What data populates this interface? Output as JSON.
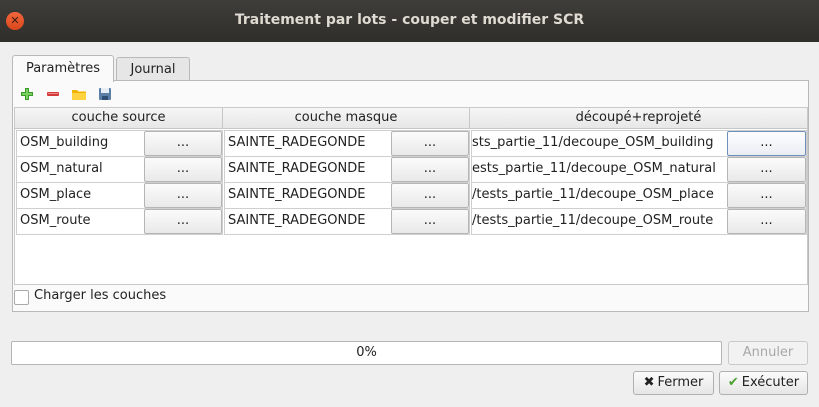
{
  "window": {
    "title": "Traitement par lots - couper et modifier SCR",
    "close_glyph": "✕"
  },
  "tabs": [
    {
      "label": "Paramètres",
      "active": true
    },
    {
      "label": "Journal",
      "active": false
    }
  ],
  "toolbar": {
    "icons": [
      "add-row-icon",
      "remove-row-icon",
      "open-folder-icon",
      "save-icon"
    ]
  },
  "table": {
    "headers": [
      "couche source",
      "couche masque",
      "découpé+reprojeté"
    ],
    "browse_label": "...",
    "rows": [
      {
        "source": "OSM_building",
        "mask": "SAINTE_RADEGONDE",
        "output": "sts_partie_11/decoupe_OSM_building"
      },
      {
        "source": "OSM_natural",
        "mask": "SAINTE_RADEGONDE",
        "output": "ests_partie_11/decoupe_OSM_natural"
      },
      {
        "source": "OSM_place",
        "mask": "SAINTE_RADEGONDE",
        "output": "/tests_partie_11/decoupe_OSM_place"
      },
      {
        "source": "OSM_route",
        "mask": "SAINTE_RADEGONDE",
        "output": "/tests_partie_11/decoupe_OSM_route"
      }
    ]
  },
  "load_layers": {
    "label": "Charger les couches",
    "checked": false
  },
  "progress": {
    "text": "0%",
    "value": 0
  },
  "buttons": {
    "cancel": "Annuler",
    "close": "Fermer",
    "run": "Exécuter"
  },
  "colors": {
    "titlebar": "#3a3935",
    "close_button": "#e85c2f",
    "add_icon": "#3a9a2a",
    "remove_icon": "#d33a3a",
    "folder_icon": "#f0b400"
  }
}
